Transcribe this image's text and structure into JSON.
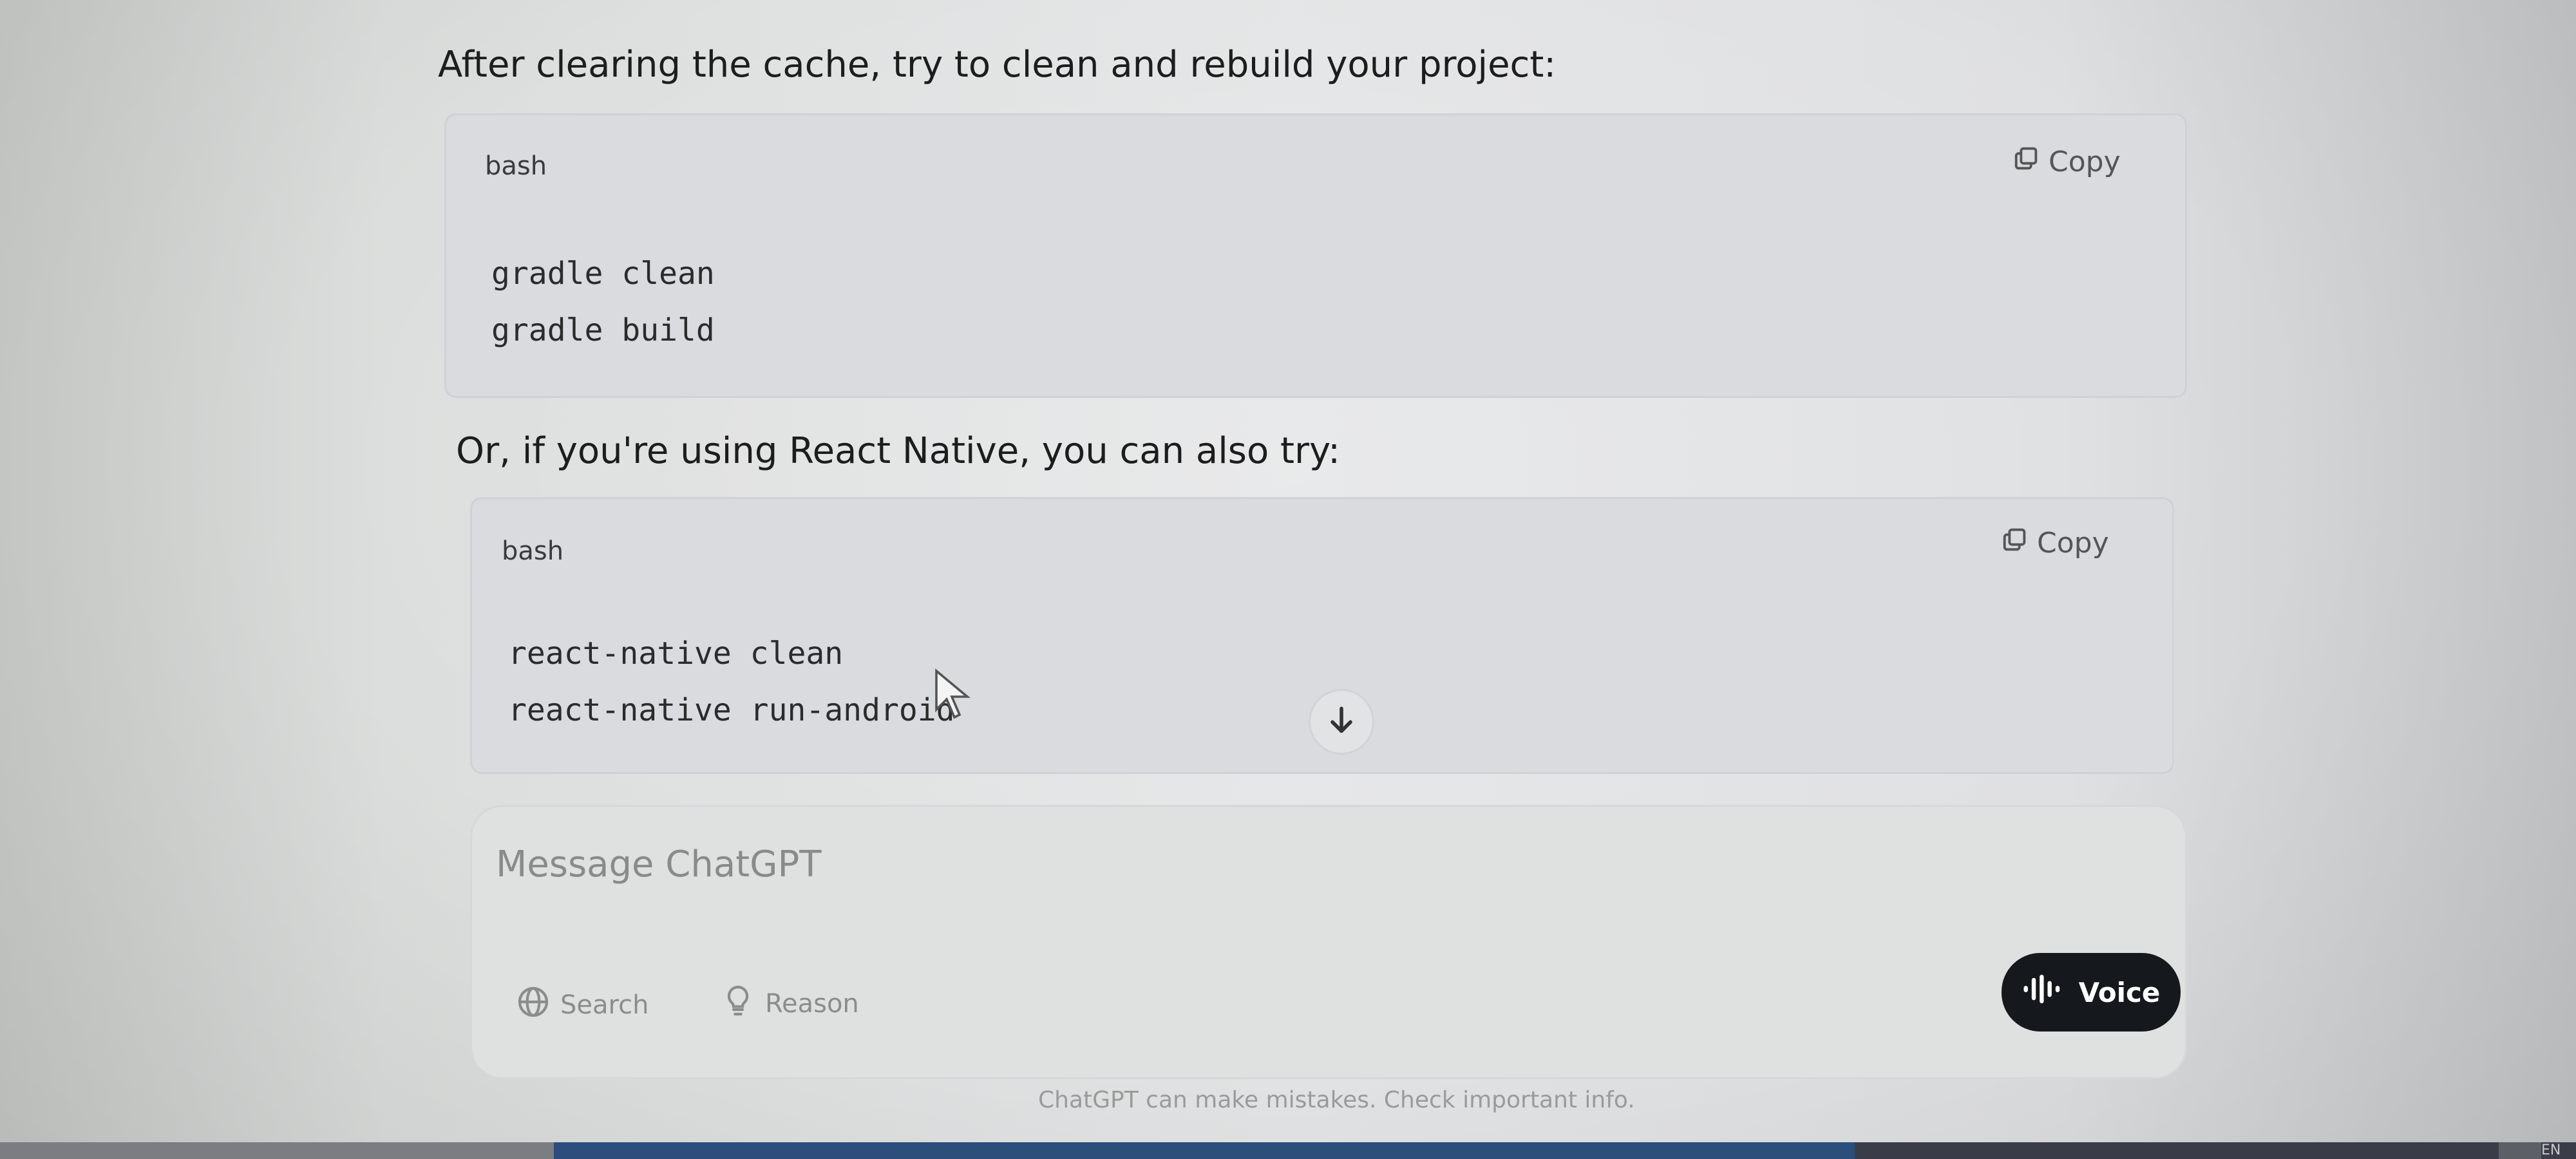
{
  "message": {
    "intro_text": "After clearing the cache, try to clean and rebuild your project:",
    "middle_text": "Or, if you're using React Native, you can also try:"
  },
  "code_blocks": [
    {
      "language": "bash",
      "copy_label": "Copy",
      "lines": [
        "gradle clean",
        "gradle build"
      ]
    },
    {
      "language": "bash",
      "copy_label": "Copy",
      "lines": [
        "react-native clean",
        "react-native run-android"
      ]
    }
  ],
  "composer": {
    "placeholder": "Message ChatGPT",
    "search_label": "Search",
    "reason_label": "Reason",
    "voice_label": "Voice"
  },
  "footer": {
    "disclaimer": "ChatGPT can make mistakes. Check important info."
  },
  "taskbar": {
    "lang_indicator": "EN"
  },
  "icons": {
    "copy": "copy-icon",
    "scroll": "arrow-down-icon",
    "search": "globe-icon",
    "reason": "lightbulb-icon",
    "voice": "voice-waveform-icon"
  },
  "colors": {
    "voice_button": "#15181c",
    "code_block_bg": "#d9dbde"
  }
}
